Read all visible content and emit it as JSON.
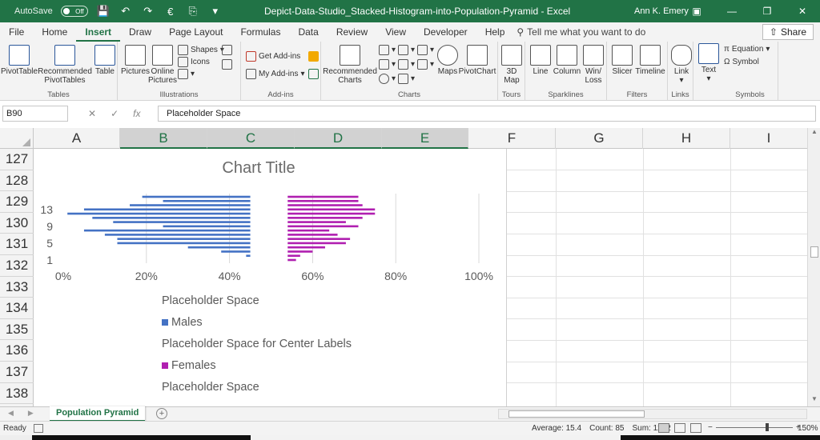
{
  "titlebar": {
    "autosave_label": "AutoSave",
    "autosave_state": "Off",
    "title": "Depict-Data-Studio_Stacked-Histogram-into-Population-Pyramid  -  Excel",
    "user": "Ann K. Emery"
  },
  "tabs": [
    "File",
    "Home",
    "Insert",
    "Draw",
    "Page Layout",
    "Formulas",
    "Data",
    "Review",
    "View",
    "Developer",
    "Help"
  ],
  "active_tab": "Insert",
  "tellme_placeholder": "Tell me what you want to do",
  "share_label": "Share",
  "ribbon": {
    "groups": {
      "tables": "Tables",
      "illustrations": "Illustrations",
      "addins": "Add-ins",
      "charts": "Charts",
      "tours": "Tours",
      "sparklines": "Sparklines",
      "filters": "Filters",
      "links": "Links",
      "symbols": "Symbols"
    },
    "buttons": {
      "pivottable": "PivotTable",
      "recommended_pivottables": "Recommended PivotTables",
      "table": "Table",
      "pictures": "Pictures",
      "online_pictures": "Online Pictures",
      "shapes": "Shapes",
      "icons": "Icons",
      "get_addins": "Get Add-ins",
      "my_addins": "My Add-ins",
      "recommended_charts": "Recommended Charts",
      "maps": "Maps",
      "pivotchart": "PivotChart",
      "map3d": "3D Map",
      "line": "Line",
      "column": "Column",
      "winloss": "Win/ Loss",
      "slicer": "Slicer",
      "timeline": "Timeline",
      "link": "Link",
      "text": "Text",
      "equation": "Equation",
      "symbol": "Symbol"
    }
  },
  "formula_bar": {
    "name_box": "B90",
    "content": "Placeholder Space"
  },
  "columns": [
    "A",
    "B",
    "C",
    "D",
    "E",
    "F",
    "G",
    "H",
    "I"
  ],
  "selected_columns": [
    "B",
    "C",
    "D",
    "E"
  ],
  "rows": [
    "127",
    "128",
    "129",
    "130",
    "131",
    "132",
    "133",
    "134",
    "135",
    "136",
    "137",
    "138"
  ],
  "chart": {
    "title": "Chart Title",
    "legend": [
      {
        "label": "Placeholder Space",
        "swatch": ""
      },
      {
        "label": "Males",
        "swatch": "#4472c4"
      },
      {
        "label": "Placeholder Space for Center Labels",
        "swatch": ""
      },
      {
        "label": "Females",
        "swatch": "#b01fb0"
      },
      {
        "label": "Placeholder Space",
        "swatch": ""
      }
    ],
    "colors": {
      "males": "#4472c4",
      "females": "#b01fb0"
    }
  },
  "chart_data": {
    "type": "bar",
    "title": "Chart Title",
    "xlabel": "",
    "ylabel": "",
    "xlim": [
      0,
      100
    ],
    "x_ticks": [
      "0%",
      "20%",
      "40%",
      "60%",
      "80%",
      "100%"
    ],
    "y_tick_labels": [
      "1",
      "5",
      "9",
      "13"
    ],
    "categories": [
      1,
      2,
      3,
      4,
      5,
      6,
      7,
      8,
      9,
      10,
      11,
      12,
      13,
      14,
      15,
      16
    ],
    "stacked": true,
    "series": [
      {
        "name": "Placeholder Space",
        "values": [
          45,
          44,
          38,
          30,
          13,
          13,
          10,
          5,
          24,
          12,
          7,
          1,
          5,
          16,
          24,
          19
        ]
      },
      {
        "name": "Males",
        "values": [
          0,
          1,
          7,
          15,
          32,
          32,
          35,
          40,
          21,
          33,
          38,
          44,
          40,
          29,
          21,
          26
        ]
      },
      {
        "name": "Placeholder Space for Center Labels",
        "values": [
          9,
          9,
          9,
          9,
          9,
          9,
          9,
          9,
          9,
          9,
          9,
          9,
          9,
          9,
          9,
          9
        ]
      },
      {
        "name": "Females",
        "values": [
          2,
          3,
          6,
          9,
          14,
          15,
          12,
          10,
          17,
          14,
          18,
          21,
          21,
          18,
          17,
          17
        ]
      },
      {
        "name": "Placeholder Space",
        "values": [
          44,
          43,
          40,
          37,
          32,
          31,
          34,
          36,
          29,
          32,
          28,
          25,
          25,
          28,
          29,
          29
        ]
      }
    ]
  },
  "sheet_tab": "Population Pyramid",
  "status": {
    "ready": "Ready",
    "average": "Average: 15.4",
    "count": "Count: 85",
    "sum": "Sum: 1232",
    "zoom": "150%"
  }
}
